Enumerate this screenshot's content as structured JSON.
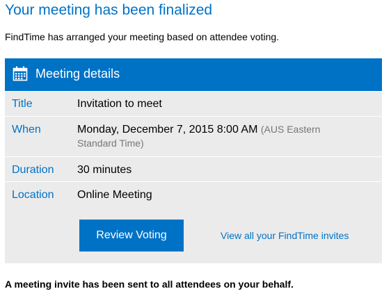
{
  "headline": "Your meeting has been finalized",
  "intro": "FindTime has arranged your meeting based on attendee voting.",
  "card": {
    "title": "Meeting details",
    "icon": "calendar-icon",
    "rows": {
      "title": {
        "label": "Title",
        "value": "Invitation to meet"
      },
      "when": {
        "label": "When",
        "value": "Monday, December 7, 2015 8:00 AM",
        "timezone_part1": "(AUS Eastern",
        "timezone_part2": "Standard Time)"
      },
      "duration": {
        "label": "Duration",
        "value": "30 minutes"
      },
      "location": {
        "label": "Location",
        "value": "Online Meeting"
      }
    },
    "review_button": "Review Voting",
    "invites_link": "View all your FindTime invites"
  },
  "footer": "A meeting invite has been sent to all attendees on your behalf.",
  "colors": {
    "accent": "#0072c6",
    "card_background": "#ebebeb",
    "muted_text": "#767676"
  }
}
